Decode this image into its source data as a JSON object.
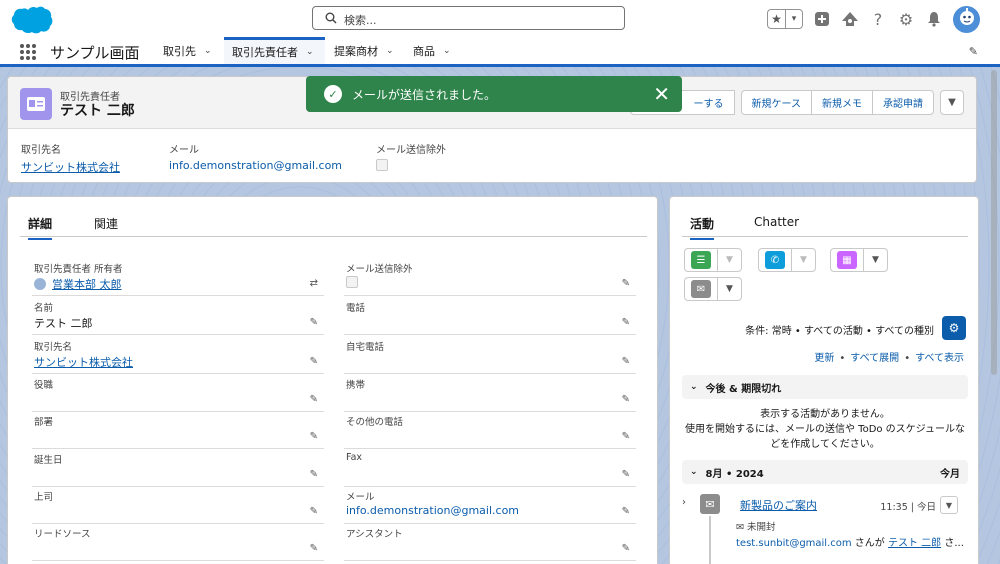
{
  "header": {
    "search_placeholder": "検索...",
    "colors": {
      "brand": "#00a1e0",
      "accent": "#1b63c2"
    }
  },
  "nav": {
    "app_name": "サンプル画面",
    "tabs": [
      {
        "label": "取引先"
      },
      {
        "label": "取引先責任者"
      },
      {
        "label": "提案商材"
      },
      {
        "label": "商品"
      }
    ]
  },
  "record": {
    "object_type": "取引先責任者",
    "name": "テスト 二郎",
    "actions": [
      {
        "label": "ーする"
      },
      {
        "label": "新規ケース"
      },
      {
        "label": "新規メモ"
      },
      {
        "label": "承認申請"
      }
    ],
    "highlights": [
      {
        "label": "取引先名",
        "value": "サンビット株式会社"
      },
      {
        "label": "メール",
        "value": "info.demonstration@gmail.com"
      },
      {
        "label": "メール送信除外",
        "value": ""
      }
    ]
  },
  "toast": {
    "message": "メールが送信されました。"
  },
  "detail": {
    "tabs": [
      {
        "label": "詳細"
      },
      {
        "label": "関連"
      }
    ],
    "left_fields": [
      {
        "label": "取引先責任者 所有者",
        "value": "営業本部 太郎"
      },
      {
        "label": "名前",
        "value": "テスト 二郎"
      },
      {
        "label": "取引先名",
        "value": "サンビット株式会社"
      },
      {
        "label": "役職",
        "value": ""
      },
      {
        "label": "部署",
        "value": ""
      },
      {
        "label": "誕生日",
        "value": ""
      },
      {
        "label": "上司",
        "value": ""
      },
      {
        "label": "リードソース",
        "value": ""
      }
    ],
    "right_fields": [
      {
        "label": "メール送信除外",
        "value": ""
      },
      {
        "label": "電話",
        "value": ""
      },
      {
        "label": "自宅電話",
        "value": ""
      },
      {
        "label": "携帯",
        "value": ""
      },
      {
        "label": "その他の電話",
        "value": ""
      },
      {
        "label": "Fax",
        "value": ""
      },
      {
        "label": "メール",
        "value": "info.demonstration@gmail.com"
      },
      {
        "label": "アシスタント",
        "value": ""
      }
    ]
  },
  "activity": {
    "tabs": [
      {
        "label": "活動"
      },
      {
        "label": "Chatter"
      }
    ],
    "filter_text": "条件: 常時 • すべての活動 • すべての種別",
    "links": {
      "refresh": "更新",
      "expand_all": "すべて展開",
      "show_all": "すべて表示"
    },
    "upcoming_header": "今後 & 期限切れ",
    "empty_line1": "表示する活動がありません。",
    "empty_line2": "使用を開始するには、メールの送信や ToDo のスケジュールな",
    "empty_line3": "どを作成してください。",
    "month_header": "8月 • 2024",
    "month_right": "今月",
    "email": {
      "subject": "新製品のご案内",
      "time": "11:35 | 今日",
      "status": "未開封",
      "from_address": "test.sunbit@gmail.com",
      "from_mid": " さんが ",
      "to_name": "テスト 二郎",
      "from_tail": " さ..."
    }
  }
}
